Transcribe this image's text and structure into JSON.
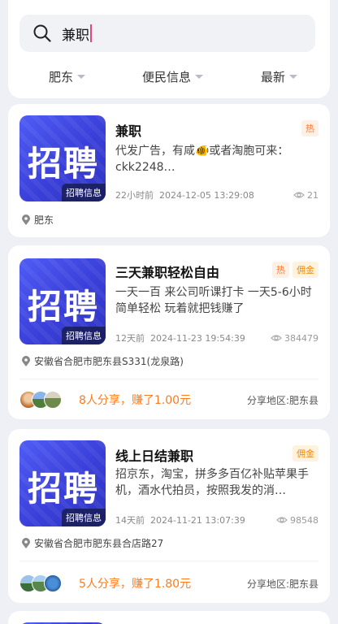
{
  "search": {
    "value": "兼职"
  },
  "filters": [
    {
      "label": "肥东"
    },
    {
      "label": "便民信息"
    },
    {
      "label": "最新"
    }
  ],
  "cards": [
    {
      "thumb_big": "招聘",
      "thumb_tag": "招聘信息",
      "title": "兼职",
      "badges": [
        "热"
      ],
      "desc": "代发广告，有咸🐠或者淘胞可来：ckk2248…",
      "time_ago": "22小时前",
      "datetime": "2024-12-05 13:29:08",
      "views": "21",
      "location": "肥东"
    },
    {
      "thumb_big": "招聘",
      "thumb_tag": "招聘信息",
      "title": "三天兼职轻松自由",
      "badges": [
        "热",
        "佣金"
      ],
      "desc": "一天一百 来公司听课打卡 一天5-6小时 简单轻松 玩着就把钱赚了",
      "time_ago": "12天前",
      "datetime": "2024-11-23 19:54:39",
      "views": "384479",
      "location": "安徽省合肥市肥东县S331(龙泉路)",
      "share_text": "8人分享，赚了1.00元",
      "share_region": "分享地区:肥东县"
    },
    {
      "thumb_big": "招聘",
      "thumb_tag": "招聘信息",
      "title": "线上日结兼职",
      "badges": [
        "佣金"
      ],
      "desc": "招京东，淘宝，拼多多百亿补贴苹果手机，酒水代拍员，按照我发的消…",
      "time_ago": "14天前",
      "datetime": "2024-11-21 13:07:39",
      "views": "98548",
      "location": "安徽省合肥市肥东县合店路27",
      "share_text": "5人分享，赚了1.80元",
      "share_region": "分享地区:肥东县"
    }
  ],
  "colors": {
    "accent": "#ff7a1a",
    "thumb_blue": "#3f46e0",
    "caret": "#e8457a"
  }
}
